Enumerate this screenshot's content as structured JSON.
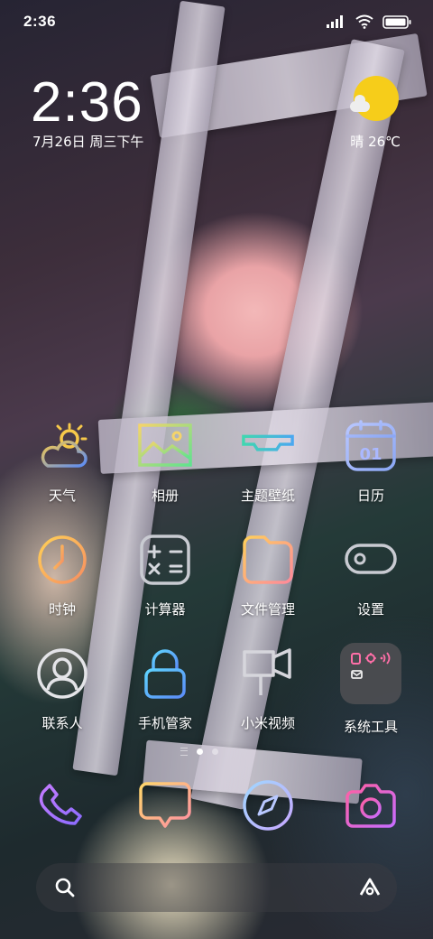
{
  "status_bar": {
    "time": "2:36",
    "icons": [
      "signal-icon",
      "wifi-icon",
      "battery-icon"
    ]
  },
  "lock_widget": {
    "clock": "2:36",
    "date": "7月26日 周三下午",
    "weather": "晴 26℃",
    "weather_icon": "sunny-cloud-icon"
  },
  "apps": [
    {
      "label": "天气",
      "icon": "weather-icon"
    },
    {
      "label": "相册",
      "icon": "gallery-icon"
    },
    {
      "label": "主题壁纸",
      "icon": "themes-icon"
    },
    {
      "label": "日历",
      "icon": "calendar-icon",
      "icon_text": "01"
    },
    {
      "label": "时钟",
      "icon": "clock-icon"
    },
    {
      "label": "计算器",
      "icon": "calculator-icon"
    },
    {
      "label": "文件管理",
      "icon": "folder-icon"
    },
    {
      "label": "设置",
      "icon": "settings-toggle-icon"
    },
    {
      "label": "联系人",
      "icon": "contacts-icon"
    },
    {
      "label": "手机管家",
      "icon": "security-lock-icon"
    },
    {
      "label": "小米视频",
      "icon": "video-camera-icon"
    },
    {
      "label": "系统工具",
      "icon": "system-tools-folder-icon"
    }
  ],
  "pager": {
    "pages": 2,
    "active": 0
  },
  "dock": [
    {
      "icon": "phone-icon"
    },
    {
      "icon": "messages-icon"
    },
    {
      "icon": "browser-compass-icon"
    },
    {
      "icon": "camera-icon"
    }
  ],
  "search_bar": {
    "left_icon": "search-icon",
    "right_icon": "assistant-icon"
  }
}
